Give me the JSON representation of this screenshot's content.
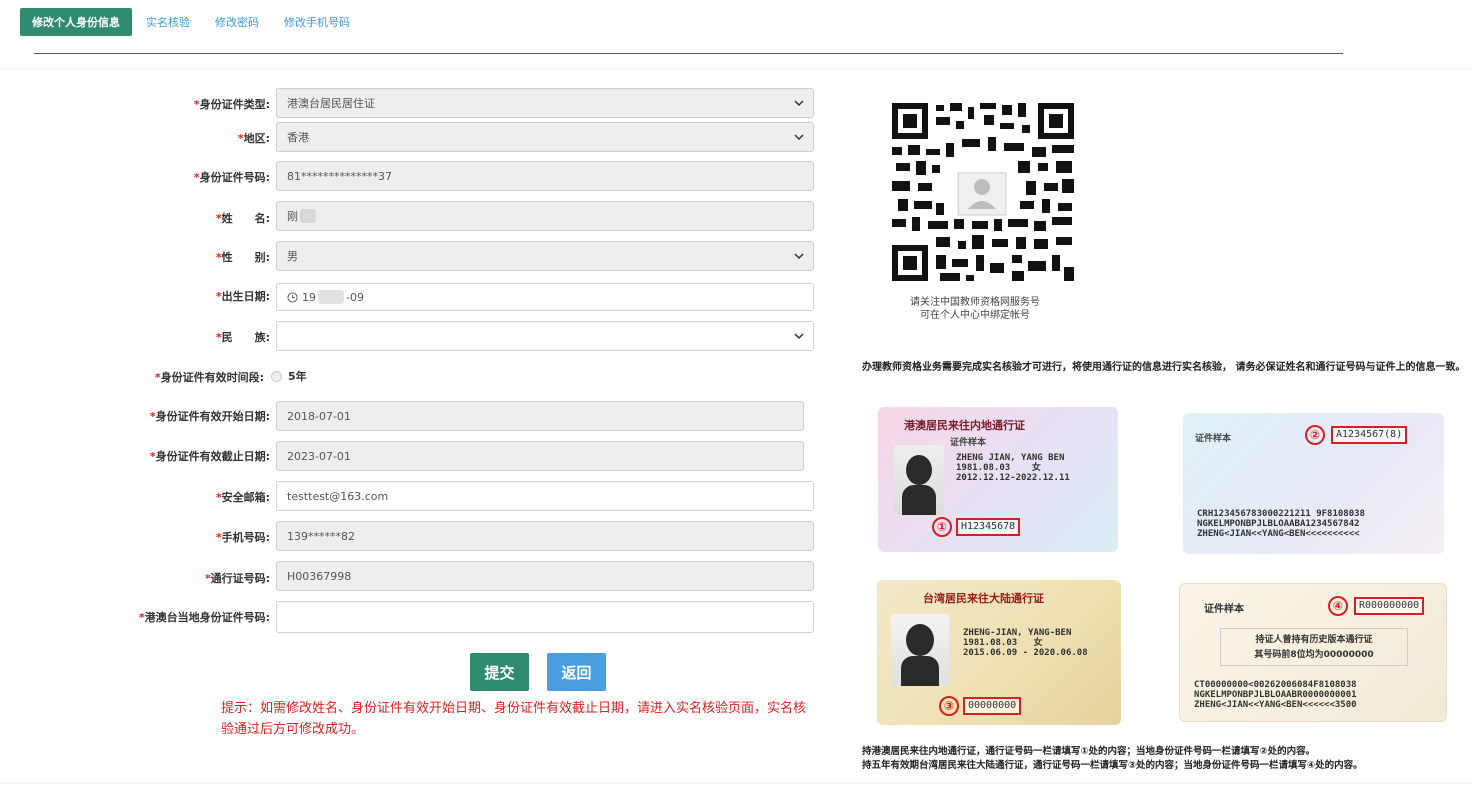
{
  "tabs": [
    "修改个人身份信息",
    "实名核验",
    "修改密码",
    "修改手机号码"
  ],
  "form": {
    "id_type": {
      "label": "身份证件类型:",
      "value": "港澳台居民居住证"
    },
    "region": {
      "label": "地区:",
      "value": "香港"
    },
    "id_number": {
      "label": "身份证件号码:",
      "value": "81**************37"
    },
    "name": {
      "label": "姓　　名:",
      "value": "刚"
    },
    "gender": {
      "label": "性　　别:",
      "value": "男"
    },
    "birth": {
      "label": "出生日期:",
      "value_prefix": "19",
      "value_suffix": "-09"
    },
    "ethnic": {
      "label": "民　　族:",
      "value": ""
    },
    "validity": {
      "label": "身份证件有效时间段:",
      "value": "5年"
    },
    "start_date": {
      "label": "身份证件有效开始日期:",
      "value": "2018-07-01"
    },
    "end_date": {
      "label": "身份证件有效截止日期:",
      "value": "2023-07-01"
    },
    "email": {
      "label": "安全邮箱:",
      "value": "testtest@163.com"
    },
    "phone": {
      "label": "手机号码:",
      "value": "139******82"
    },
    "permit": {
      "label": "通行证号码:",
      "value": "H00367998"
    },
    "local_id": {
      "label": "港澳台当地身份证件号码:",
      "value": ""
    },
    "required_mark": "*"
  },
  "buttons": {
    "submit": "提交",
    "back": "返回"
  },
  "hint": "提示：如需修改姓名、身份证件有效开始日期、身份证件有效截止日期，请进入实名核验页面，实名核验通过后方可修改成功。",
  "qr_caption": [
    "请关注中国教师资格网服务号",
    "可在个人中心中绑定帐号"
  ],
  "notice": "办理教师资格业务需要完成实名核验才可进行，将使用通行证的信息进行实名核验， 请务必保证姓名和通行证号码与证件上的信息一致。",
  "cards": {
    "hk_title": "港澳居民来往内地通行证",
    "hk_num": "H12345678",
    "hk_back_num": "A1234567(8)",
    "hk_back_mrz": [
      "CRH123456783000221211 9F8108038",
      "NGKELMPONBPJLBLOAABA1234567842",
      "ZHENG<JIAN<<YANG<BEN<<<<<<<<<<"
    ],
    "tw_title": "台湾居民来往大陆通行证",
    "tw_num": "00000000",
    "tw_back_num": "R000000000",
    "tw_back_text": [
      "持证人曾持有历史版本通行证",
      "其号码前8位均为00000000"
    ],
    "tw_back_mrz": [
      "CT00000000<00262006084F8108038",
      "NGKELMPONBPJLBLOAABR0000000001",
      "ZHENG<JIAN<<YANG<BEN<<<<<<3500"
    ],
    "sample_label": "证件样本",
    "circle_nums": [
      "①",
      "②",
      "③",
      "④"
    ]
  },
  "footer": [
    "持港澳居民来往内地通行证，通行证号码一栏请填写①处的内容；当地身份证件号码一栏请填写②处的内容。",
    "持五年有效期台湾居民来往大陆通行证，通行证号码一栏请填写③处的内容；当地身份证件号码一栏请填写④处的内容。"
  ],
  "colors": {
    "accent": "#2e8b6f",
    "link": "#3a9bd9",
    "required": "#e02020",
    "back_button": "#4a9ee0"
  }
}
